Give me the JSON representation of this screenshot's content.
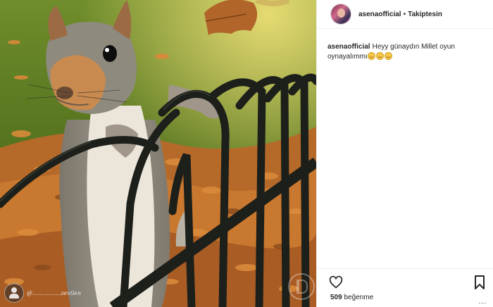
{
  "post": {
    "username": "asenaofficial",
    "separator": "•",
    "follow_status": "Takiptesin",
    "caption": {
      "username": "asenaofficial",
      "text": "Heyy günaydın Millet oyun oynayalımmı",
      "emojis": [
        "grinning-face",
        "grinning-face",
        "grinning-face"
      ]
    },
    "likes": {
      "count": "509",
      "label": "beğenme"
    },
    "more_label": "..."
  },
  "photo": {
    "subject": "squirrel-on-fence",
    "watermark_user": "@................sevilen"
  },
  "colors": {
    "text": "#262626",
    "border": "#efefef",
    "grass": "#4d6b23",
    "leaves": "#c9782f",
    "fence": "#1c1f1a"
  }
}
